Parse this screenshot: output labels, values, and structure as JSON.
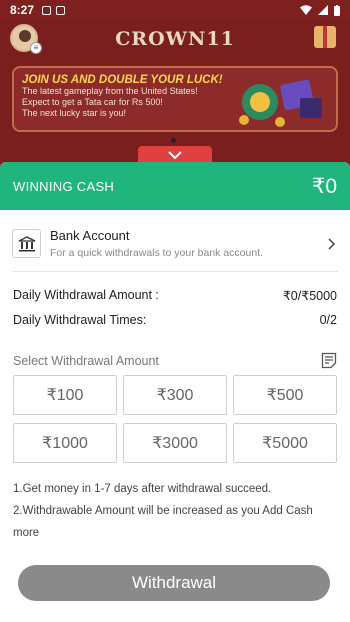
{
  "status_bar": {
    "time": "8:27"
  },
  "header": {
    "brand": "CROWN11"
  },
  "banner": {
    "headline": "JOIN US AND DOUBLE YOUR LUCK!",
    "lines": [
      "The latest gameplay from the United States!",
      "Expect to get a Tata car for Rs 500!",
      "The next lucky star is you!"
    ]
  },
  "cash": {
    "label": "WINNING CASH",
    "amount": "₹0"
  },
  "bank": {
    "title": "Bank Account",
    "subtitle": "For a quick withdrawals to your bank account."
  },
  "limits": {
    "amount_label": "Daily Withdrawal Amount :",
    "amount_value": "₹0/₹5000",
    "times_label": "Daily Withdrawal Times:",
    "times_value": "0/2"
  },
  "select_label": "Select Withdrawal Amount",
  "amounts": [
    "₹100",
    "₹300",
    "₹500",
    "₹1000",
    "₹3000",
    "₹5000"
  ],
  "notes": [
    "1.Get money in 1-7 days after withdrawal succeed.",
    "2.Withdrawable Amount will be increased as you Add Cash more"
  ],
  "withdraw_button": "Withdrawal",
  "colors": {
    "accent_green": "#1fb57c",
    "header_red": "#7a1e1e",
    "tab_red": "#e04040",
    "button_gray": "#8a8a8a"
  }
}
